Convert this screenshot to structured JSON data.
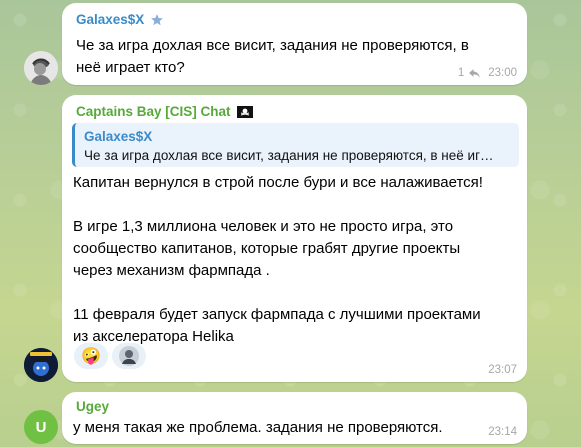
{
  "messages": [
    {
      "sender": "Galaxes$X",
      "text": "Че за игра дохлая все висит, задания не проверяются, в\nнеё играет кто?",
      "replies_count": "1",
      "time": "23:00"
    },
    {
      "sender": "Captains Bay [CIS] Chat",
      "quote": {
        "name": "Galaxes$X",
        "text": "Че за игра дохлая все висит, задания не проверяются, в неё иг…"
      },
      "text": "Капитан вернулся в строй после бури и все налаживается!\n\nВ игре 1,3 миллиона человек и это не просто игра, это\nсообщество капитанов, которые грабят другие проекты\nчерез механизм фармпада .\n\n11 февраля будет запуск фармпада с лучшими проектами\nиз акселератора Helika",
      "reactions": [
        "🤪",
        ""
      ],
      "time": "23:07"
    },
    {
      "sender": "Ugey",
      "avatar_letter": "U",
      "text": "у меня такая же проблема. задания не проверяются.",
      "time": "23:14"
    }
  ],
  "colors": {
    "sender_name": "#3a8bc9",
    "avatar_ugey": "#6fc043"
  },
  "icons": {
    "star": "star-icon",
    "pirate_flag": "pirate-flag-icon",
    "reply_arrow": "reply-arrow-icon"
  }
}
